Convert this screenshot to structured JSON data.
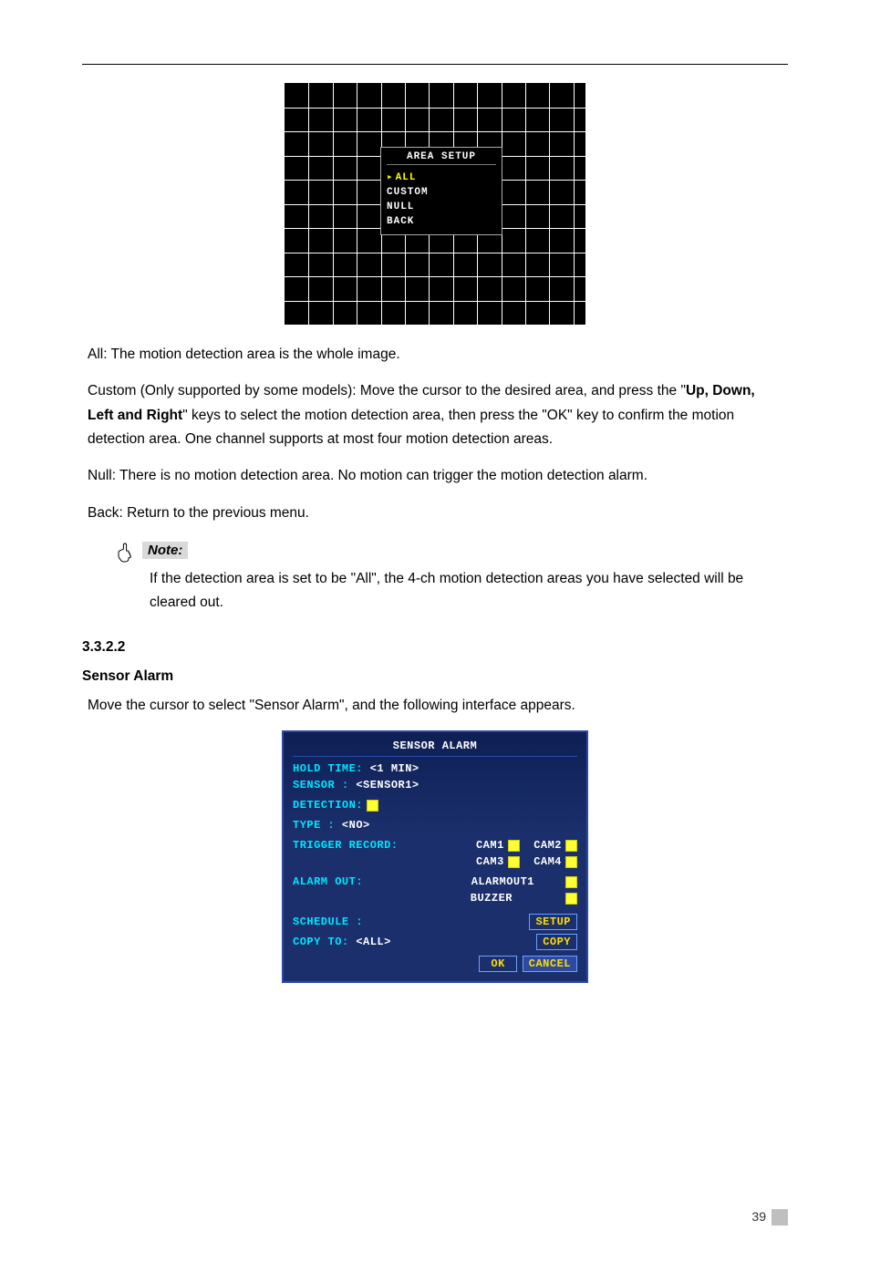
{
  "area_setup": {
    "title": "AREA SETUP",
    "items": [
      "ALL",
      "CUSTOM",
      "NULL",
      "BACK"
    ],
    "selected_index": 0
  },
  "paragraphs": {
    "all": "All: The motion detection area is the whole image.",
    "custom_intro": "Custom (Only supported by some models): Move the cursor to the desired area, and press the \"",
    "custom_keys": "Up, Down, Left and Right",
    "custom_rest": "\" keys to select the motion detection area, then press the \"OK\" key to confirm the motion detection area. One channel supports at most four motion detection areas.",
    "null": "Null: There is no motion detection area. No motion can trigger the motion detection alarm.",
    "back": "Back: Return to the previous menu."
  },
  "note": {
    "label": "Note:",
    "body": "If the detection area is set to be \"All\", the 4-ch motion detection areas you have selected will be cleared out."
  },
  "section": {
    "number": "3.3.2.2",
    "title": "Sensor Alarm",
    "intro": "Move the cursor to select \"Sensor Alarm\", and the following interface appears."
  },
  "sensor_panel": {
    "title": "SENSOR ALARM",
    "hold_time_label": "HOLD TIME:",
    "hold_time_value": "<1 MIN>",
    "sensor_label": "SENSOR  :",
    "sensor_value": "<SENSOR1>",
    "detection_label": "DETECTION:",
    "type_label": "TYPE    :",
    "type_value": "<NO>",
    "trigger_label": "TRIGGER RECORD:",
    "cams": [
      "CAM1",
      "CAM2",
      "CAM3",
      "CAM4"
    ],
    "alarm_out_label": "ALARM OUT:",
    "alarm_out_items": [
      "ALARMOUT1",
      "BUZZER"
    ],
    "schedule_label": "SCHEDULE :",
    "setup_btn": "SETUP",
    "copy_label": "COPY  TO:",
    "copy_value": "<ALL>",
    "copy_btn": "COPY",
    "ok": "OK",
    "cancel": "CANCEL"
  },
  "page_number": "39"
}
